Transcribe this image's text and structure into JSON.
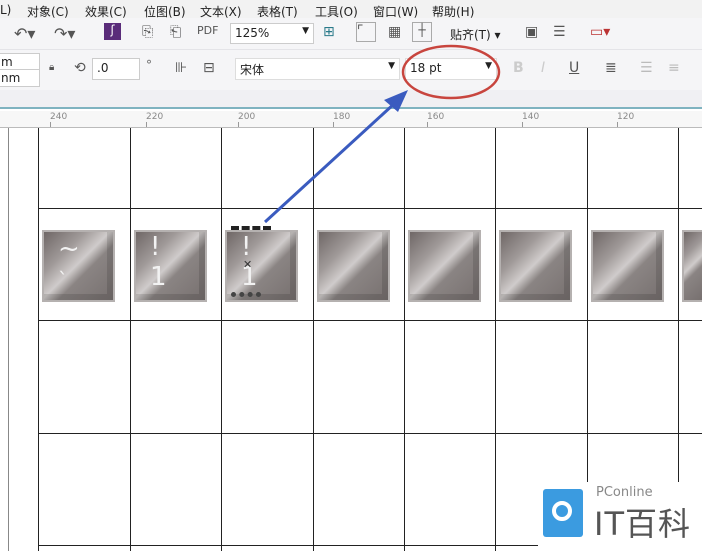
{
  "menu": [
    "L)",
    "对象(C)",
    "效果(C)",
    "位图(B)",
    "文本(X)",
    "表格(T)",
    "工具(O)",
    "窗口(W)",
    "帮助(H)"
  ],
  "toolbar1": {
    "zoom": "125%",
    "snap": "贴齐(T)"
  },
  "toolbar2": {
    "unit1": "m",
    "unit2": "nm",
    "rotation": ".0",
    "degree": "°",
    "font": "宋体",
    "font_size": "18 pt"
  },
  "ruler": [
    "240",
    "220",
    "200",
    "180",
    "160",
    "140",
    "120"
  ],
  "tiles": [
    {
      "top": "~",
      "bottom": "`"
    },
    {
      "top": "!",
      "bottom": "1"
    },
    {
      "top": "!",
      "bottom": "1"
    },
    {},
    {},
    {},
    {},
    {}
  ],
  "annotation": {
    "highlight_color": "#c8453e",
    "arrow_color": "#3a5bbf"
  },
  "watermark": {
    "brand": "PConline",
    "name": "IT百科"
  }
}
